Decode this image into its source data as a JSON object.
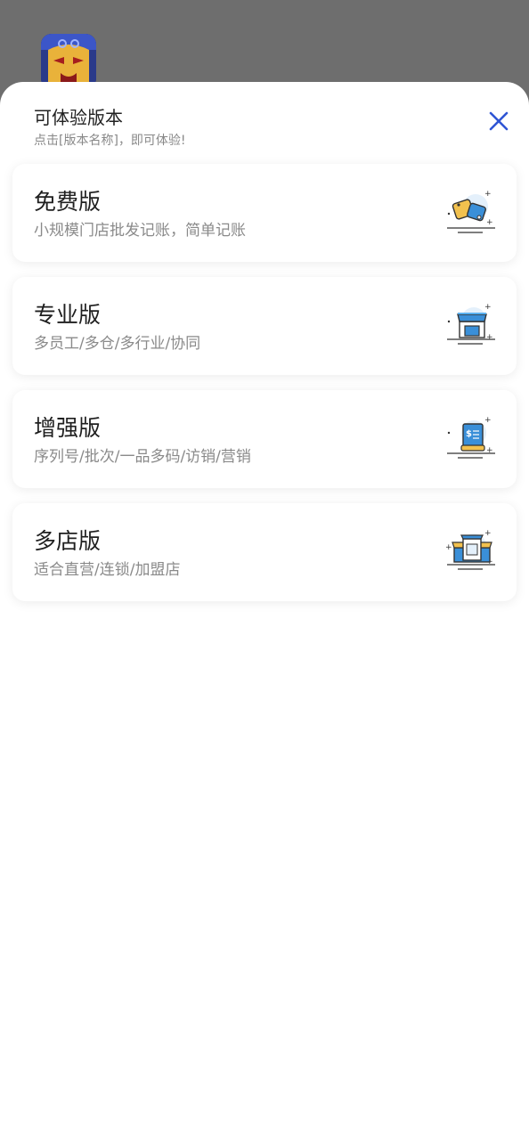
{
  "sheet": {
    "title": "可体验版本",
    "subtitle": "点击[版本名称]，即可体验!"
  },
  "versions": [
    {
      "name": "免费版",
      "desc": "小规模门店批发记账，简单记账",
      "icon": "price-tags-icon"
    },
    {
      "name": "专业版",
      "desc": "多员工/多仓/多行业/协同",
      "icon": "storefront-icon"
    },
    {
      "name": "增强版",
      "desc": "序列号/批次/一品多码/访销/营销",
      "icon": "ledger-book-icon"
    },
    {
      "name": "多店版",
      "desc": "适合直营/连锁/加盟店",
      "icon": "chain-stores-icon"
    }
  ],
  "colors": {
    "accent": "#2f55d4",
    "title_text": "#222222",
    "desc_text": "#8a8a8a",
    "overlay": "#6e6e6e"
  }
}
